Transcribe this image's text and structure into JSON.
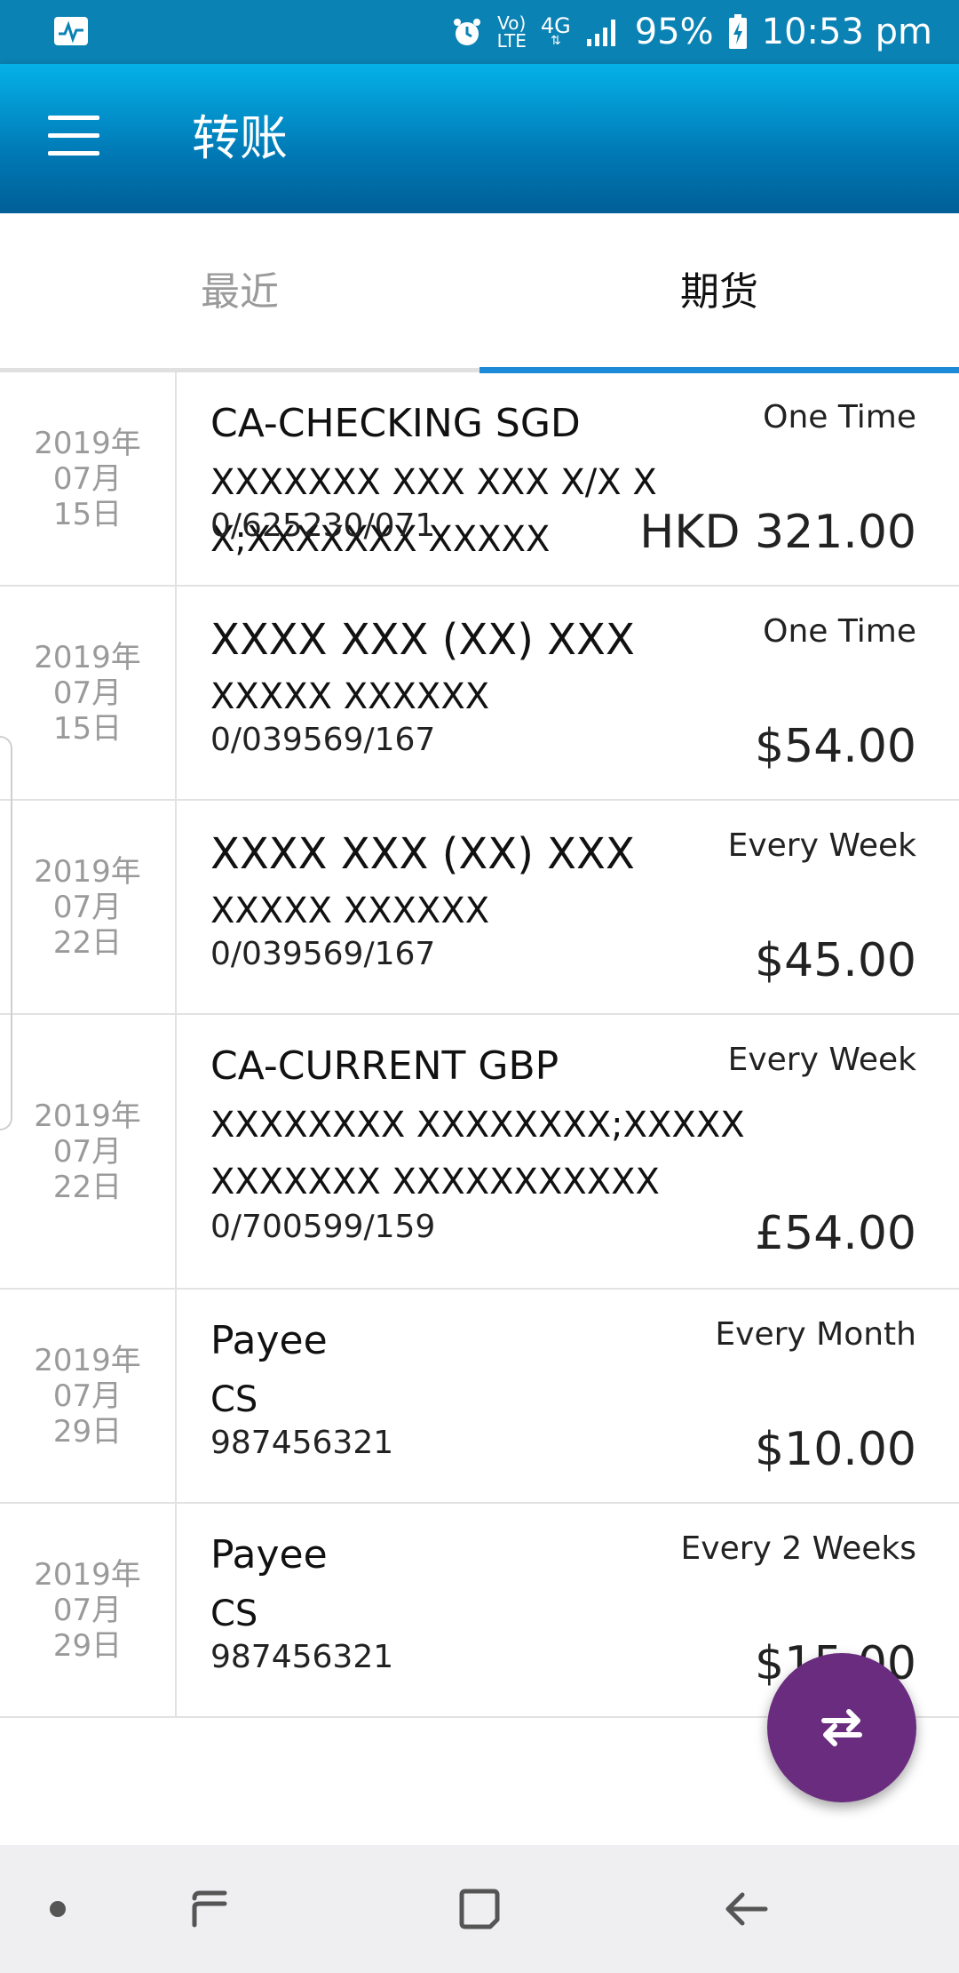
{
  "status_bar": {
    "network_label_top": "Vo)",
    "network_label_bottom": "LTE",
    "signal_type": "4G",
    "battery": "95%",
    "time": "10:53 pm",
    "icons": [
      "activity-icon",
      "alarm-icon",
      "volte-icon",
      "signal-icon",
      "battery-charging-icon"
    ]
  },
  "header": {
    "title": "转账",
    "menu_icon": "hamburger-menu-icon"
  },
  "tabs": {
    "recent": "最近",
    "future": "期货",
    "active": "future"
  },
  "transfers": [
    {
      "date_year": "2019年",
      "date_month": "07月",
      "date_day": "15日",
      "title": "CA-CHECKING SGD",
      "description": "XXXXXXX XXX XXX X/X X X;XXXXXXX XXXXX",
      "account": "0/625230/071",
      "frequency": "One Time",
      "amount": "HKD 321.00"
    },
    {
      "date_year": "2019年",
      "date_month": "07月",
      "date_day": "15日",
      "title": "XXXX XXX (XX) XXX",
      "description": "XXXXX XXXXXX",
      "account": "0/039569/167",
      "frequency": "One Time",
      "amount": "$54.00"
    },
    {
      "date_year": "2019年",
      "date_month": "07月",
      "date_day": "22日",
      "title": "XXXX XXX (XX) XXX",
      "description": "XXXXX XXXXXX",
      "account": "0/039569/167",
      "frequency": "Every Week",
      "amount": "$45.00"
    },
    {
      "date_year": "2019年",
      "date_month": "07月",
      "date_day": "22日",
      "title": "CA-CURRENT GBP",
      "description": "XXXXXXXX XXXXXXXX;XXXXX XXXXXXX XXXXXXXXXXX",
      "account": "0/700599/159",
      "frequency": "Every Week",
      "amount": "£54.00"
    },
    {
      "date_year": "2019年",
      "date_month": "07月",
      "date_day": "29日",
      "title": "Payee",
      "description": "CS",
      "account": "987456321",
      "frequency": "Every Month",
      "amount": "$10.00"
    },
    {
      "date_year": "2019年",
      "date_month": "07月",
      "date_day": "29日",
      "title": "Payee",
      "description": "CS",
      "account": "987456321",
      "frequency": "Every 2 Weeks",
      "amount": "$15.00"
    }
  ],
  "fab": {
    "icon": "transfer-arrows-icon"
  },
  "nav_bar": {
    "icons": [
      "dot-icon",
      "recent-apps-icon",
      "home-icon",
      "back-icon"
    ]
  },
  "colors": {
    "status_bar": "#0a82b4",
    "app_bar_top": "#05b1e8",
    "app_bar_bottom": "#005f96",
    "tab_indicator": "#1e8bd8",
    "fab": "#6a2c7e",
    "nav_bar": "#efeff1"
  }
}
